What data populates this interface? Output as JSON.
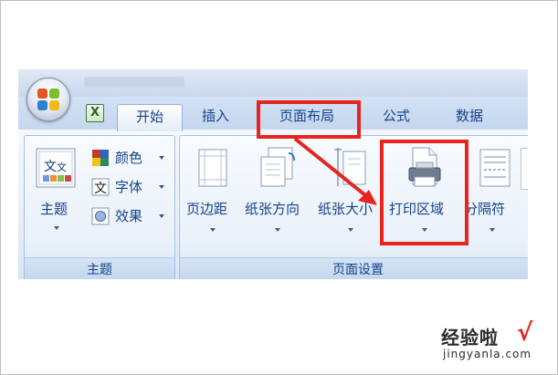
{
  "tabs": [
    {
      "label": "开始",
      "active": true
    },
    {
      "label": "插入",
      "active": false
    },
    {
      "label": "页面布局",
      "active": false
    },
    {
      "label": "公式",
      "active": false
    },
    {
      "label": "数据",
      "active": false
    }
  ],
  "ribbon": {
    "theme_group": {
      "label": "主题",
      "big_button": "主题",
      "small_buttons": [
        "颜色",
        "字体",
        "效果"
      ]
    },
    "page_setup_group": {
      "label": "页面设置",
      "buttons": [
        "页边距",
        "纸张方向",
        "纸张大小",
        "打印区域",
        "分隔符"
      ]
    }
  },
  "icons": {
    "office_button": "office-logo-icon",
    "excel": "excel-icon"
  },
  "watermark": {
    "brand": "经验啦",
    "url": "jingyanla.com"
  },
  "colors": {
    "highlight": "#e8241f",
    "ribbon_text": "#15428b"
  }
}
